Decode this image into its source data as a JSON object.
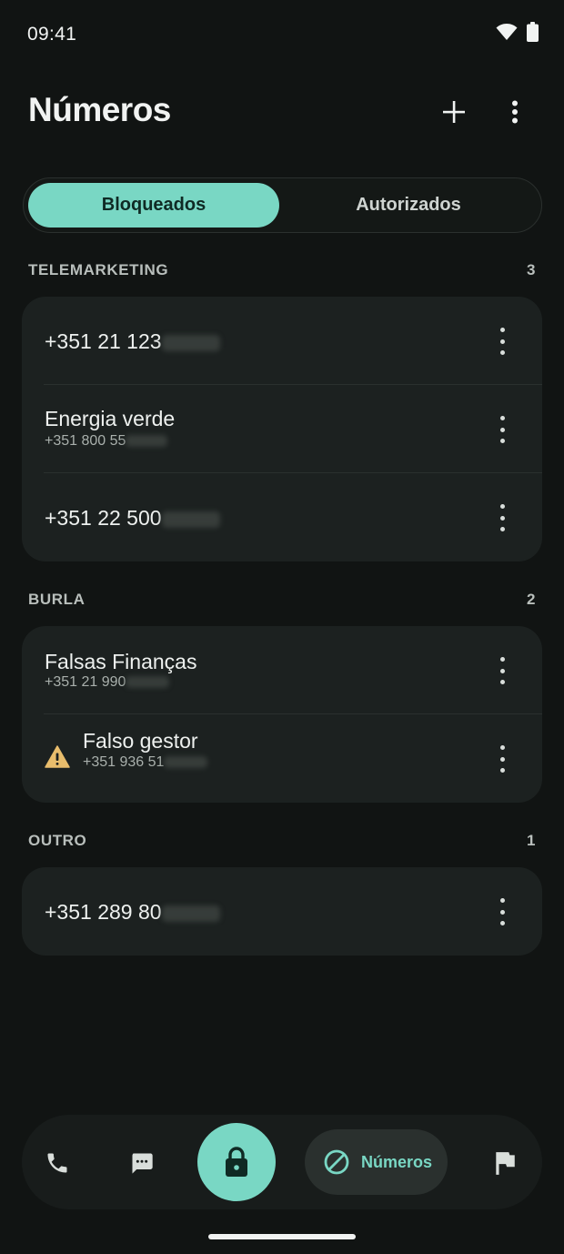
{
  "status_bar": {
    "time": "09:41"
  },
  "app_bar": {
    "title": "Números"
  },
  "tabs": [
    {
      "label": "Bloqueados",
      "active": true
    },
    {
      "label": "Autorizados",
      "active": false
    }
  ],
  "sections": [
    {
      "title": "TELEMARKETING",
      "count": "3",
      "rows": [
        {
          "main": "+351 21 123"
        },
        {
          "main": "Energia verde",
          "sub": "+351 800 55"
        },
        {
          "main": "+351 22 500"
        }
      ]
    },
    {
      "title": "BURLA",
      "count": "2",
      "rows": [
        {
          "main": "Falsas Finanças",
          "sub": "+351 21 990"
        },
        {
          "main": "Falso gestor",
          "sub": "+351 936 51",
          "icon": "warning-icon"
        }
      ]
    },
    {
      "title": "OUTRO",
      "count": "1",
      "rows": [
        {
          "main": "+351 289 80"
        }
      ]
    }
  ],
  "bottom_nav": {
    "items": [
      "phone-icon",
      "message-icon",
      "lock-icon",
      "block-icon",
      "flag-icon"
    ],
    "active_label": "Números"
  },
  "colors": {
    "accent": "#79d7c4",
    "background": "#111413",
    "card": "#1c2120",
    "warning": "#e8bd6c"
  }
}
